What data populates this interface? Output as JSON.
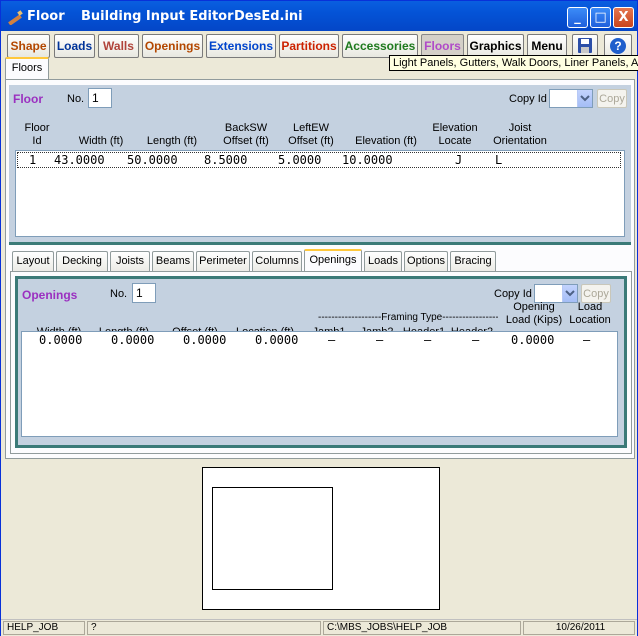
{
  "window": {
    "title_app": "Floor",
    "title_editor": "Building Input Editor",
    "title_file": "DesEd.ini",
    "buttons": {
      "minimize": "_",
      "maximize": "□",
      "close": "X"
    }
  },
  "toolbar": {
    "buttons": [
      {
        "label": "Shape",
        "color": "#b34700"
      },
      {
        "label": "Loads",
        "color": "#003399"
      },
      {
        "label": "Walls",
        "color": "#b0433a"
      },
      {
        "label": "Openings",
        "color": "#b34700"
      },
      {
        "label": "Extensions",
        "color": "#0044cc"
      },
      {
        "label": "Partitions",
        "color": "#cc2200"
      },
      {
        "label": "Accessories",
        "color": "#1e7a1e"
      },
      {
        "label": "Floors",
        "color": "#b04ac8"
      },
      {
        "label": "Graphics",
        "color": "#000000"
      },
      {
        "label": "Menu",
        "color": "#000000"
      }
    ],
    "icons": [
      "save-icon",
      "help-icon"
    ],
    "tooltip": "Light Panels, Gutters, Walk Doors, Liner Panels, Acc"
  },
  "floors_tab": {
    "label": "Floors"
  },
  "floor": {
    "section_title": "Floor",
    "no_label": "No.",
    "no_value": "1",
    "copy_id_label": "Copy Id",
    "copy_button": "Copy",
    "headers": [
      {
        "l1": "Floor",
        "l2": "Id"
      },
      {
        "l1": "",
        "l2": "Width (ft)"
      },
      {
        "l1": "",
        "l2": "Length (ft)"
      },
      {
        "l1": "BackSW",
        "l2": "Offset (ft)"
      },
      {
        "l1": "LeftEW",
        "l2": "Offset (ft)"
      },
      {
        "l1": "",
        "l2": "Elevation (ft)"
      },
      {
        "l1": "Elevation",
        "l2": "Locate"
      },
      {
        "l1": "Joist",
        "l2": "Orientation"
      }
    ],
    "row": [
      "1",
      "43.0000",
      "50.0000",
      "8.5000",
      "5.0000",
      "10.0000",
      "J",
      "L"
    ]
  },
  "subtabs": [
    "Layout",
    "Decking",
    "Joists",
    "Beams",
    "Perimeter",
    "Columns",
    "Openings",
    "Loads",
    "Options",
    "Bracing"
  ],
  "subtab_selected": "Openings",
  "openings": {
    "section_title": "Openings",
    "no_label": "No.",
    "no_value": "1",
    "copy_id_label": "Copy Id",
    "copy_button": "Copy",
    "framing_type": "-------------------Framing Type-------------------",
    "headers": [
      {
        "l1": "",
        "l2": "Width (ft)"
      },
      {
        "l1": "",
        "l2": "Length (ft)"
      },
      {
        "l1": "",
        "l2": "Offset (ft)"
      },
      {
        "l1": "",
        "l2": "Location (ft)"
      },
      {
        "l1": "",
        "l2": "Jamb1"
      },
      {
        "l1": "",
        "l2": "Jamb2"
      },
      {
        "l1": "",
        "l2": "Header1"
      },
      {
        "l1": "",
        "l2": "Header2"
      },
      {
        "l1": "Opening",
        "l2": "Load (Kips)"
      },
      {
        "l1": "Load",
        "l2": "Location"
      }
    ],
    "row": [
      "0.0000",
      "0.0000",
      "0.0000",
      "0.0000",
      "–",
      "–",
      "–",
      "–",
      "0.0000",
      "–"
    ]
  },
  "status": {
    "job": "HELP_JOB",
    "help": "?",
    "path": "C:\\MBS_JOBS\\HELP_JOB",
    "date": "10/26/2011"
  }
}
